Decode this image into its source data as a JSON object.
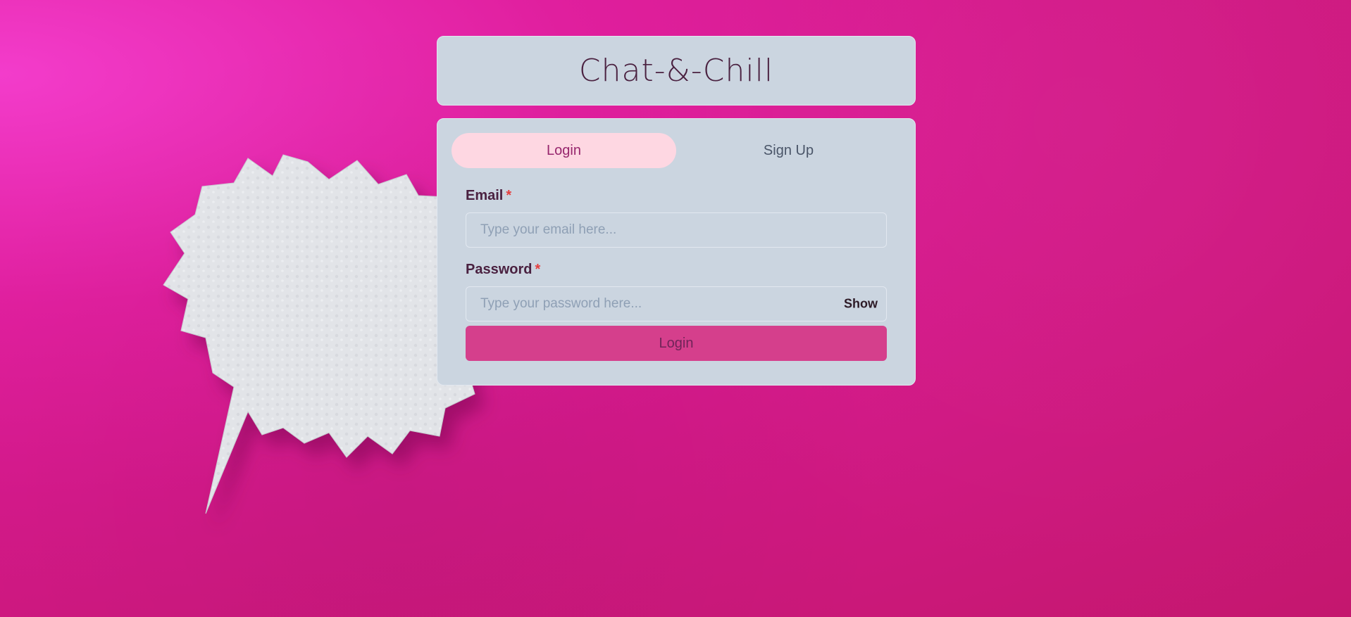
{
  "app": {
    "title": "Chat-&-Chill"
  },
  "tabs": [
    {
      "label": "Login",
      "active": true
    },
    {
      "label": "Sign Up",
      "active": false
    }
  ],
  "form": {
    "email_label": "Email",
    "email_required": "*",
    "email_placeholder": "Type your email here...",
    "email_value": "",
    "password_label": "Password",
    "password_required": "*",
    "password_placeholder": "Type your password here...",
    "password_value": "",
    "show_label": "Show",
    "submit_label": "Login"
  },
  "colors": {
    "background": "#d4198a",
    "panel": "#cbd5e0",
    "active_tab": "#fed7e2",
    "active_tab_text": "#97266d",
    "button": "#d53f8c",
    "required": "#e53e3e"
  },
  "icons": {
    "decor": "speech-bubble-icon"
  }
}
